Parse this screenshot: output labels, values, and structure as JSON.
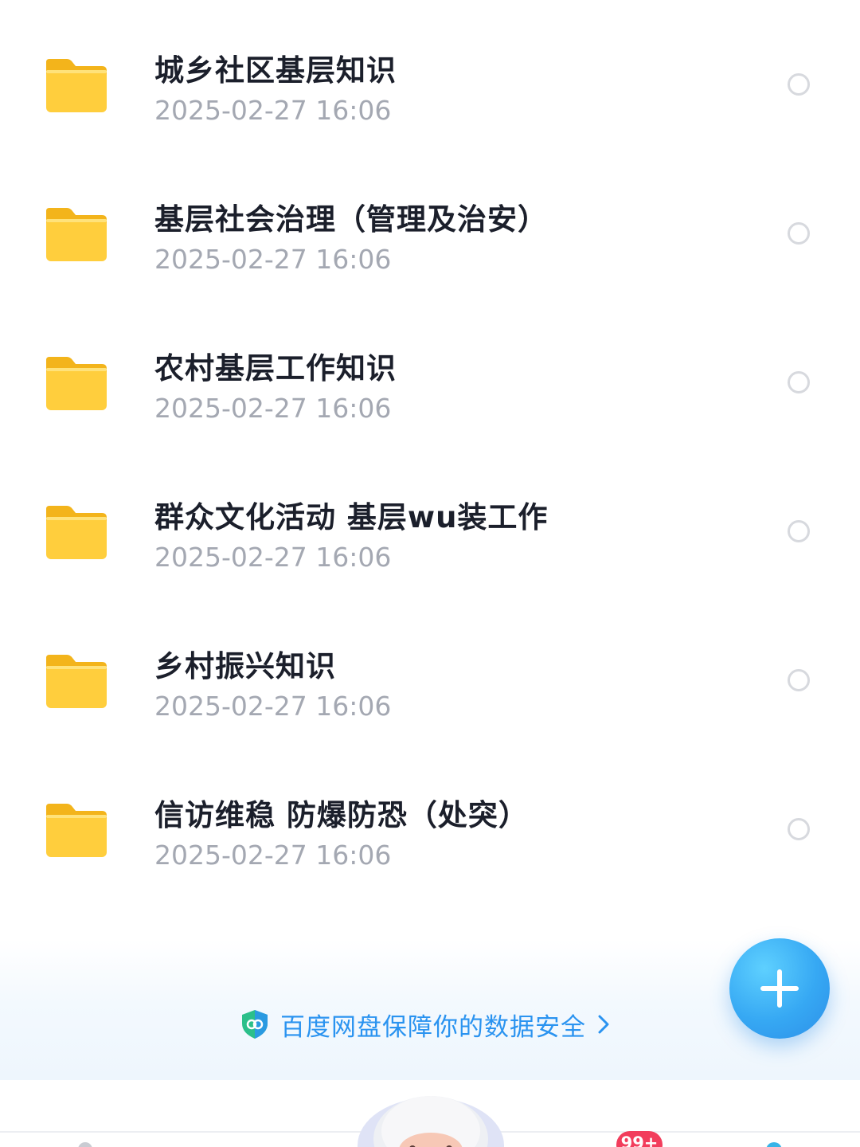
{
  "files": [
    {
      "name": "城乡社区基层知识",
      "date": "2025-02-27  16:06"
    },
    {
      "name": "基层社会治理（管理及治安）",
      "date": "2025-02-27  16:06"
    },
    {
      "name": "农村基层工作知识",
      "date": "2025-02-27  16:06"
    },
    {
      "name": "群众文化活动 基层wu装工作",
      "date": "2025-02-27  16:06"
    },
    {
      "name": "乡村振兴知识",
      "date": "2025-02-27  16:06"
    },
    {
      "name": "信访维稳 防爆防恐（处突）",
      "date": "2025-02-27  16:06"
    }
  ],
  "security_banner": {
    "text": "百度网盘保障你的数据安全",
    "icon": "shield-icon"
  },
  "fab": {
    "icon": "plus-icon"
  },
  "tab_bar": {
    "badge": "99+"
  },
  "colors": {
    "folder": "#ffc93a",
    "accent": "#2a93f0",
    "fab": "#36a8f3",
    "badge": "#f23d5c"
  }
}
